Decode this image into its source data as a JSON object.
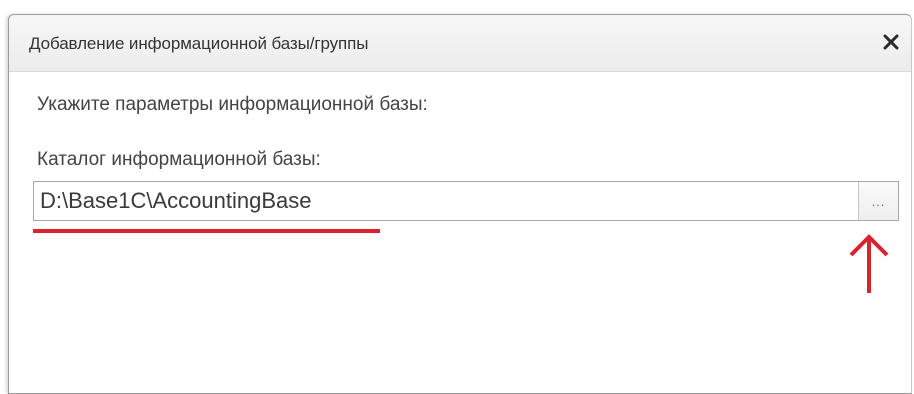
{
  "window": {
    "title": "Добавление информационной базы/группы",
    "close_icon": "close-icon"
  },
  "form": {
    "prompt": "Укажите параметры информационной базы:",
    "directory_label": "Каталог информационной базы:",
    "directory_value": "D:\\Base1C\\AccountingBase",
    "browse_label": "..."
  },
  "annotations": {
    "highlight_color": "#d9232d",
    "arrow_icon": "arrow-up-icon"
  }
}
